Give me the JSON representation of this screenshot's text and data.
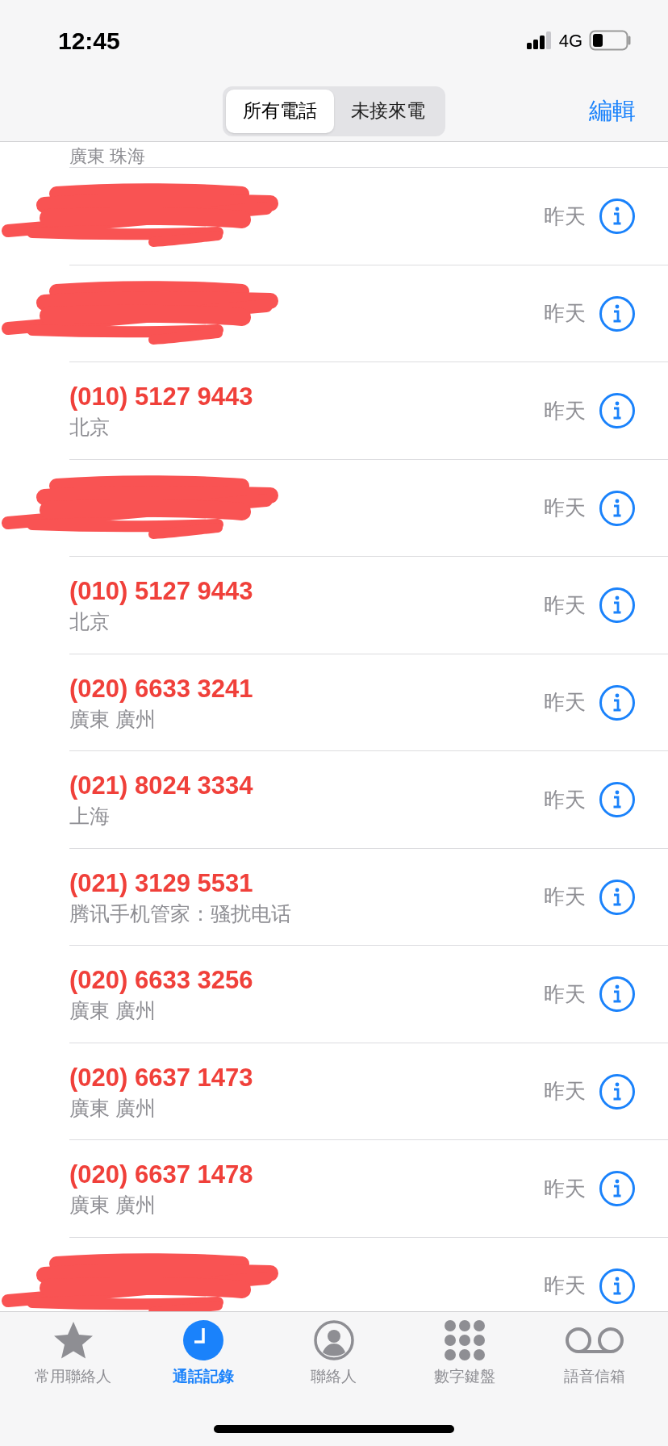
{
  "status_bar": {
    "time": "12:45",
    "network": "4G"
  },
  "segments": [
    {
      "label": "所有電話",
      "selected": true
    },
    {
      "label": "未接來電",
      "selected": false
    }
  ],
  "edit_button": "編輯",
  "partial_row": {
    "subtitle": "廣東 珠海"
  },
  "calls": [
    {
      "kind": "redacted",
      "time": "昨天"
    },
    {
      "kind": "redacted",
      "time": "昨天"
    },
    {
      "kind": "call",
      "number": "(010) 5127 9443",
      "location": "北京",
      "time": "昨天",
      "missed": true
    },
    {
      "kind": "redacted",
      "time": "昨天"
    },
    {
      "kind": "call",
      "number": "(010) 5127 9443",
      "location": "北京",
      "time": "昨天",
      "missed": true
    },
    {
      "kind": "call",
      "number": "(020) 6633 3241",
      "location": "廣東 廣州",
      "time": "昨天",
      "missed": true
    },
    {
      "kind": "call",
      "number": "(021) 8024 3334",
      "location": "上海",
      "time": "昨天",
      "missed": true
    },
    {
      "kind": "call",
      "number": "(021) 3129 5531",
      "location": "腾讯手机管家：骚扰电话",
      "time": "昨天",
      "missed": true
    },
    {
      "kind": "call",
      "number": "(020) 6633 3256",
      "location": "廣東 廣州",
      "time": "昨天",
      "missed": true
    },
    {
      "kind": "call",
      "number": "(020) 6637 1473",
      "location": "廣東 廣州",
      "time": "昨天",
      "missed": true
    },
    {
      "kind": "call",
      "number": "(020) 6637 1478",
      "location": "廣東 廣州",
      "time": "昨天",
      "missed": true
    },
    {
      "kind": "redacted",
      "time": "昨天"
    }
  ],
  "tabs": [
    {
      "kind": "favorites",
      "label": "常用聯絡人",
      "selected": false
    },
    {
      "kind": "recents",
      "label": "通話記錄",
      "selected": true
    },
    {
      "kind": "contacts",
      "label": "聯絡人",
      "selected": false
    },
    {
      "kind": "keypad",
      "label": "數字鍵盤",
      "selected": false
    },
    {
      "kind": "voicemail",
      "label": "語音信箱",
      "selected": false
    }
  ]
}
